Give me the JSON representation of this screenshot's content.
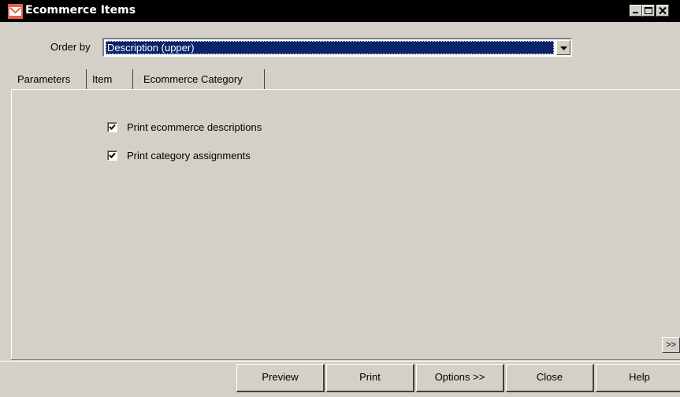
{
  "window": {
    "title": "Ecommerce Items"
  },
  "order_by": {
    "label": "Order by",
    "value": "Description (upper)"
  },
  "tabs": [
    {
      "label": "Parameters",
      "active": true
    },
    {
      "label": "Item",
      "active": false
    },
    {
      "label": "Ecommerce Category",
      "active": false
    }
  ],
  "options": [
    {
      "label": "Print ecommerce descriptions",
      "checked": true
    },
    {
      "label": "Print category assignments",
      "checked": true
    }
  ],
  "more_button": {
    "label": ">>"
  },
  "buttons": {
    "preview": "Preview",
    "print": "Print",
    "options": "Options >>",
    "close": "Close",
    "help": "Help"
  },
  "colors": {
    "titlebar": "#000000",
    "selection": "#0a246a",
    "face": "#d4d0c8"
  }
}
